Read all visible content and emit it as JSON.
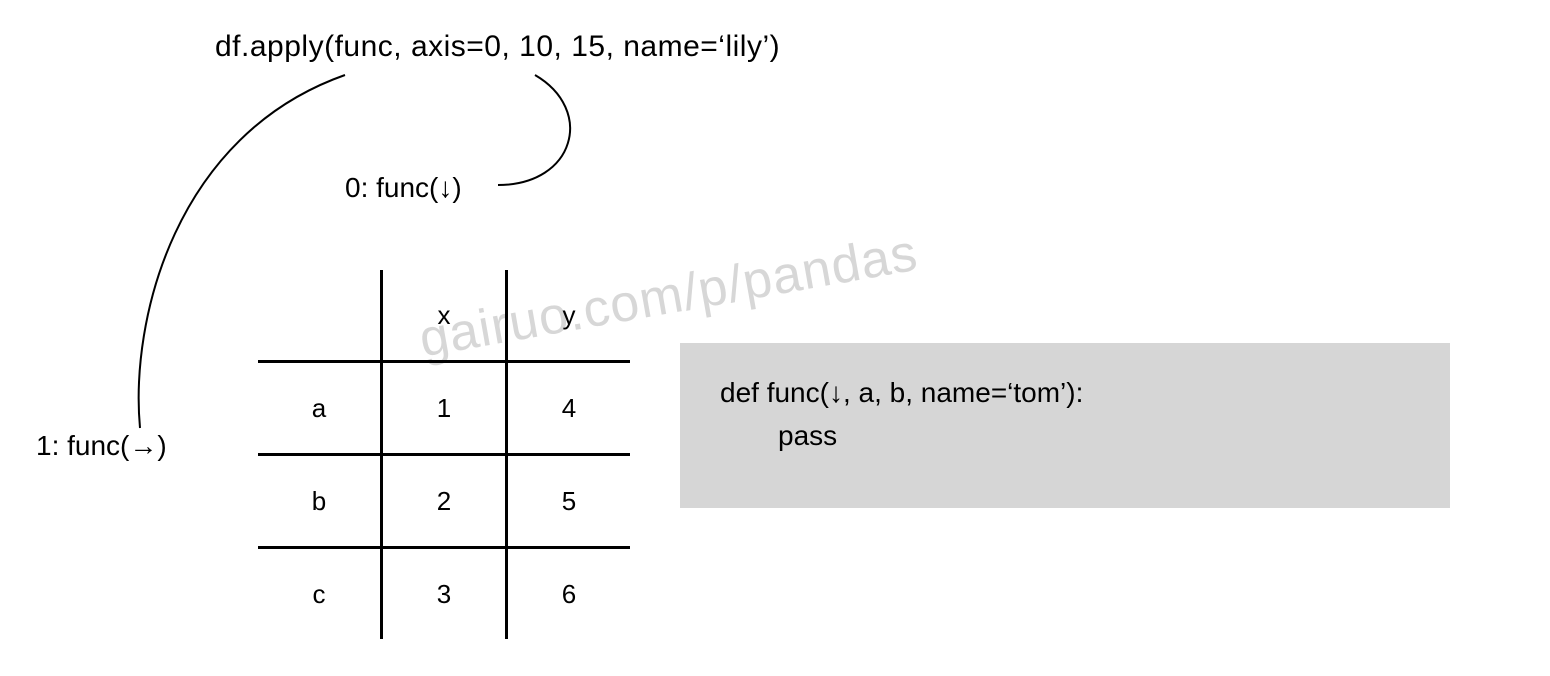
{
  "title": "df.apply(func, axis=0, 10, 15, name=‘lily’)",
  "axis0_label": "0:  func(↓)",
  "axis1_label": "1: func(→)",
  "table": {
    "columns": [
      "x",
      "y"
    ],
    "index": [
      "a",
      "b",
      "c"
    ],
    "data": [
      [
        1,
        4
      ],
      [
        2,
        5
      ],
      [
        3,
        6
      ]
    ]
  },
  "code": {
    "line1": "def func(↓, a, b, name=‘tom’):",
    "line2": "pass"
  },
  "watermark": "gairuo.com/p/pandas"
}
